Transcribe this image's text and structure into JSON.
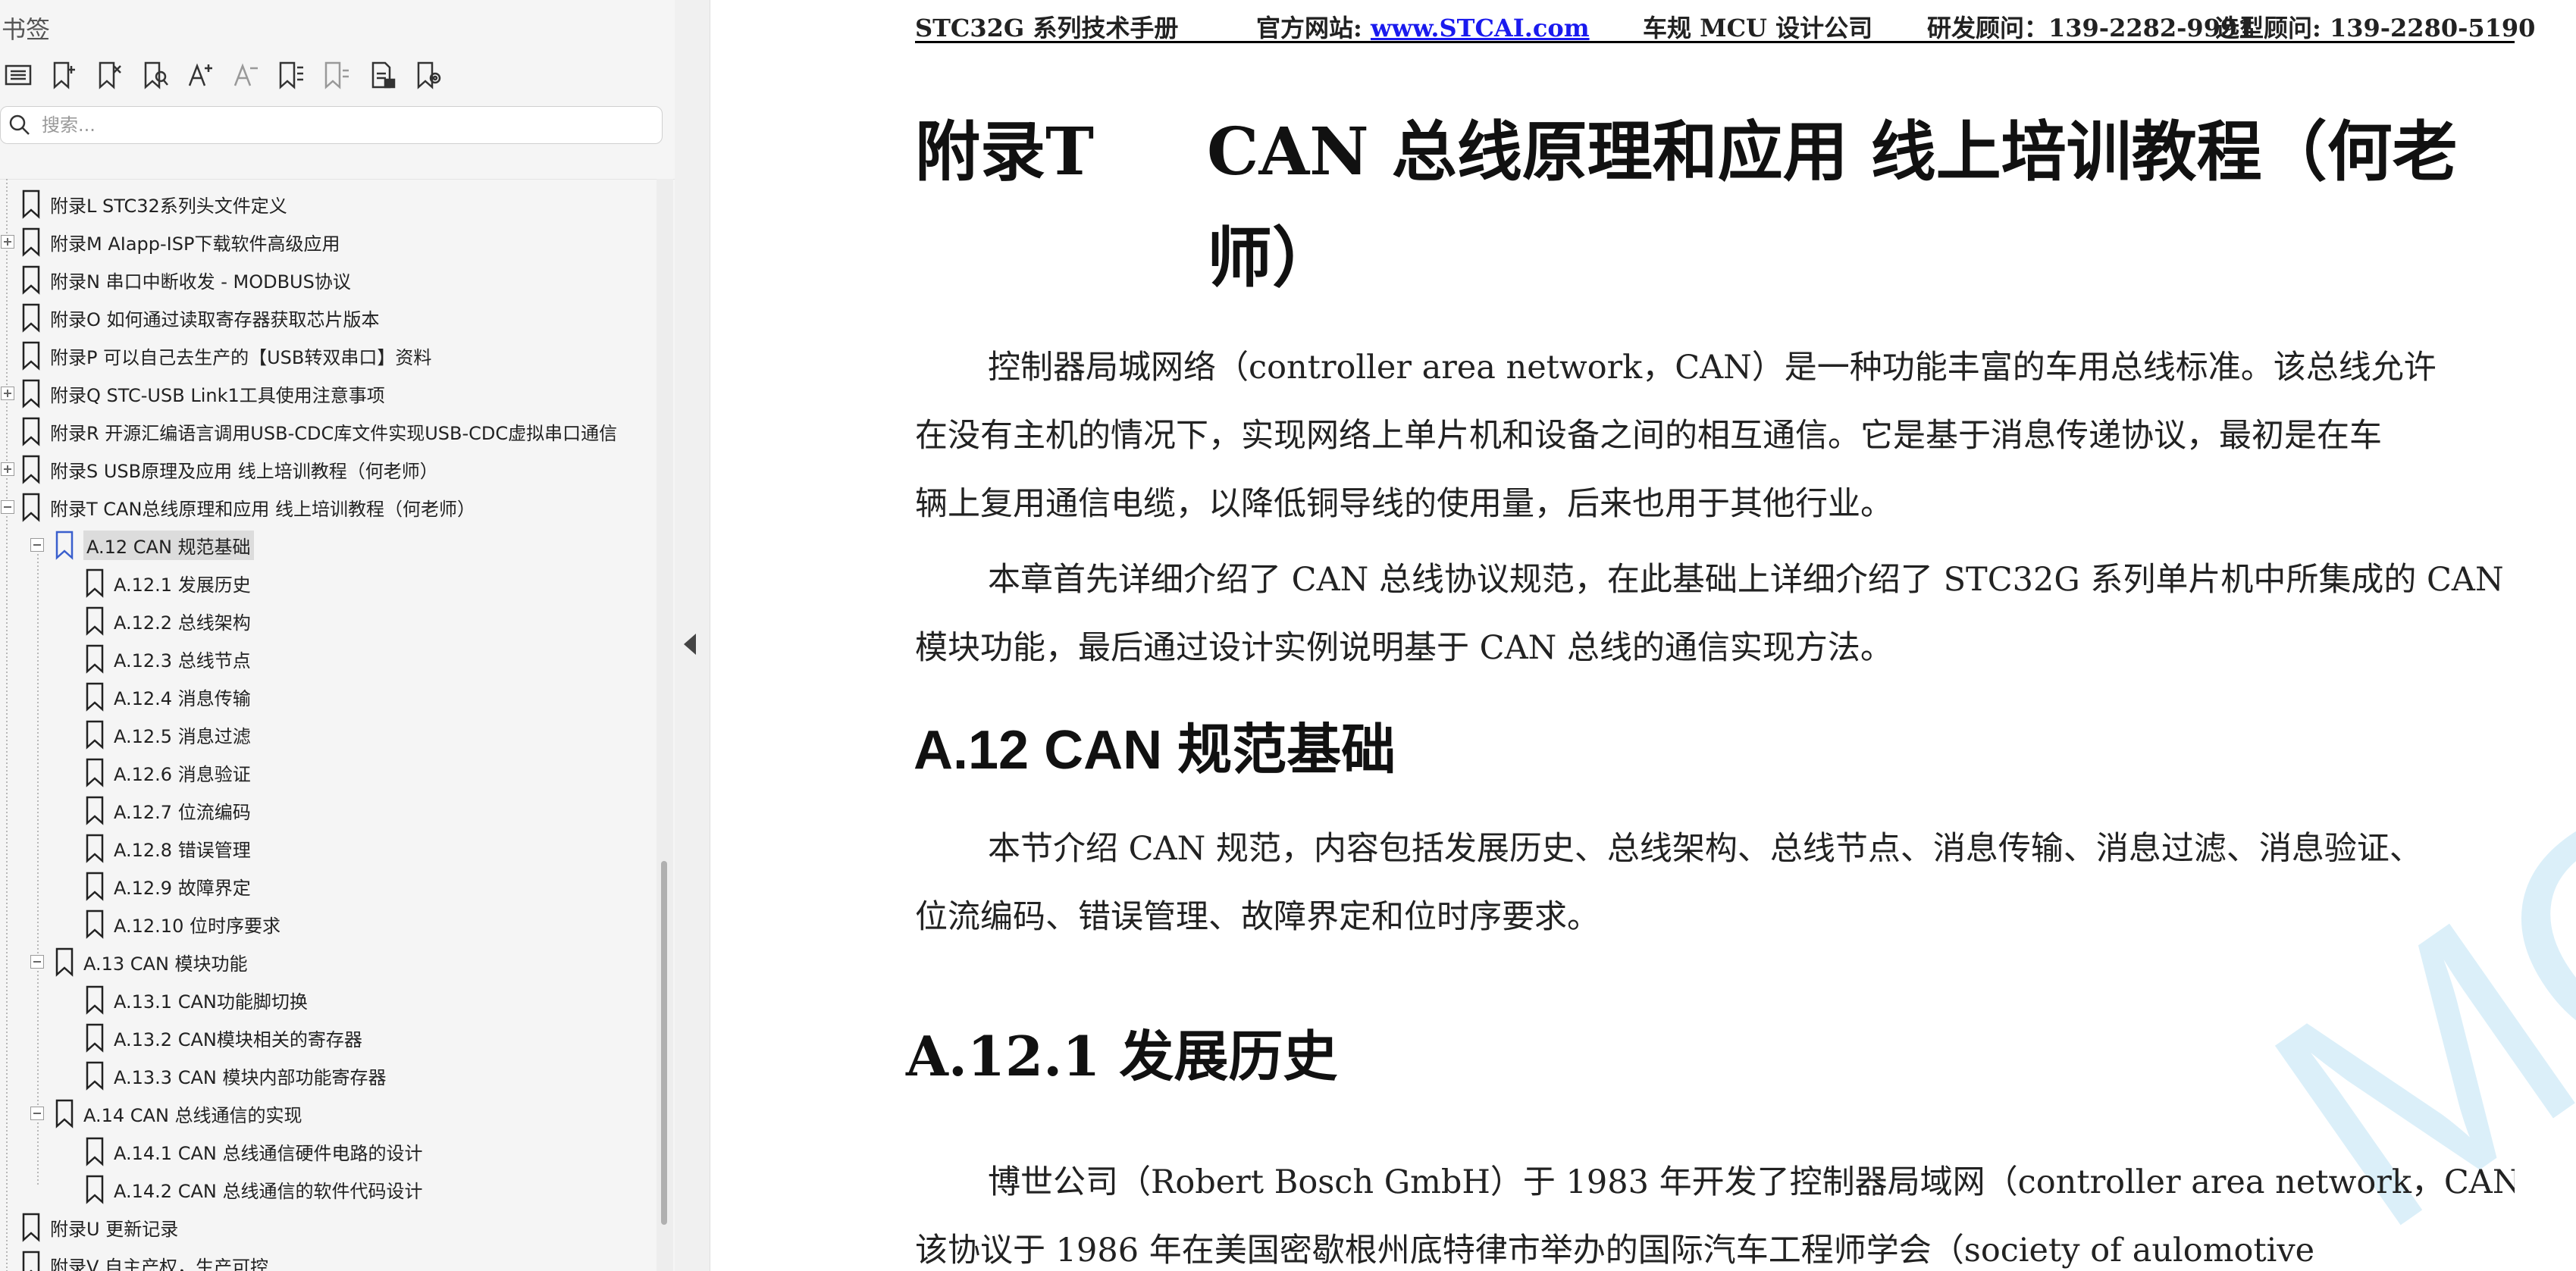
{
  "sidebar": {
    "title": "书签",
    "search_placeholder": "搜索...",
    "tools": [
      "list-icon",
      "add-bookmark-icon",
      "delete-bookmark-icon",
      "find-bookmark-icon",
      "increase-font-icon",
      "decrease-font-icon",
      "expand-all-icon",
      "collapse-all-icon",
      "export-bookmark-icon",
      "bookmark-settings-icon"
    ],
    "items": [
      {
        "label": "附录L  STC32系列头文件定义",
        "level": 0,
        "expander": "none"
      },
      {
        "label": "附录M  AIapp-ISP下载软件高级应用",
        "level": 0,
        "expander": "plus"
      },
      {
        "label": "附录N  串口中断收发 - MODBUS协议",
        "level": 0,
        "expander": "none"
      },
      {
        "label": "附录O  如何通过读取寄存器获取芯片版本",
        "level": 0,
        "expander": "none"
      },
      {
        "label": "附录P  可以自己去生产的【USB转双串口】资料",
        "level": 0,
        "expander": "none"
      },
      {
        "label": "附录Q  STC-USB Link1工具使用注意事项",
        "level": 0,
        "expander": "plus"
      },
      {
        "label": "附录R  开源汇编语言调用USB-CDC库文件实现USB-CDC虚拟串口通信",
        "level": 0,
        "expander": "none"
      },
      {
        "label": "附录S  USB原理及应用 线上培训教程（何老师）",
        "level": 0,
        "expander": "plus"
      },
      {
        "label": "附录T  CAN总线原理和应用 线上培训教程（何老师）",
        "level": 0,
        "expander": "minus"
      },
      {
        "label": "A.12 CAN 规范基础",
        "level": 1,
        "expander": "minus",
        "selected": true
      },
      {
        "label": "A.12.1 发展历史",
        "level": 2,
        "expander": "none"
      },
      {
        "label": "A.12.2 总线架构",
        "level": 2,
        "expander": "none"
      },
      {
        "label": "A.12.3 总线节点",
        "level": 2,
        "expander": "none"
      },
      {
        "label": "A.12.4 消息传输",
        "level": 2,
        "expander": "none"
      },
      {
        "label": "A.12.5 消息过滤",
        "level": 2,
        "expander": "none"
      },
      {
        "label": "A.12.6 消息验证",
        "level": 2,
        "expander": "none"
      },
      {
        "label": "A.12.7 位流编码",
        "level": 2,
        "expander": "none"
      },
      {
        "label": "A.12.8 错误管理",
        "level": 2,
        "expander": "none"
      },
      {
        "label": "A.12.9 故障界定",
        "level": 2,
        "expander": "none"
      },
      {
        "label": "A.12.10 位时序要求",
        "level": 2,
        "expander": "none"
      },
      {
        "label": "A.13 CAN 模块功能",
        "level": 1,
        "expander": "minus"
      },
      {
        "label": "A.13.1 CAN功能脚切换",
        "level": 2,
        "expander": "none"
      },
      {
        "label": "A.13.2 CAN模块相关的寄存器",
        "level": 2,
        "expander": "none"
      },
      {
        "label": "A.13.3 CAN 模块内部功能寄存器",
        "level": 2,
        "expander": "none"
      },
      {
        "label": "A.14 CAN 总线通信的实现",
        "level": 1,
        "expander": "minus"
      },
      {
        "label": "A.14.1 CAN 总线通信硬件电路的设计",
        "level": 2,
        "expander": "none"
      },
      {
        "label": "A.14.2 CAN 总线通信的软件代码设计",
        "level": 2,
        "expander": "none"
      },
      {
        "label": "附录U  更新记录",
        "level": 0,
        "expander": "none"
      },
      {
        "label": "附录V  自主产权，生产可控",
        "level": 0,
        "expander": "none"
      }
    ]
  },
  "document": {
    "header": {
      "manual": "STC32G 系列技术手册",
      "site_label": "官方网站: ",
      "site_link": "www.STCAI.com",
      "company": "车规 MCU 设计公司",
      "rd_contact": "研发顾问：139-2282-9991",
      "sel_contact": "选型顾问: 139-2280-5190"
    },
    "appendix_label": "附录T",
    "title_line1": "CAN  总线原理和应用  线上培训教程（何老",
    "title_line2": "师）",
    "intro_lines": [
      "控制器局城网络（controller area network，CAN）是一种功能丰富的车用总线标准。该总线允许",
      "在没有主机的情况下，实现网络上单片机和设备之间的相互通信。它是基于消息传递协议，最初是在车",
      "辆上复用通信电缆，以降低铜导线的使用量，后来也用于其他行业。"
    ],
    "chapter_lines": [
      "本章首先详细介绍了 CAN 总线协议规范，在此基础上详细介绍了 STC32G 系列单片机中所集成的 CAN",
      "模块功能，最后通过设计实例说明基于 CAN 总线的通信实现方法。"
    ],
    "section_heading": "A.12  CAN  规范基础",
    "section_lines": [
      "本节介绍 CAN 规范，内容包括发展历史、总线架构、总线节点、消息传输、消息过滤、消息验证、",
      "位流编码、错误管理、故障界定和位时序要求。"
    ],
    "subsection_heading": "A.12.1     发展历史",
    "history_lines": [
      "博世公司（Robert Bosch GmbH）于 1983 年开发了控制器局域网（controller area network，CAN）。",
      "该协议于  1986  年在美国密歇根州底特律市举办的国际汽车工程师学会（society  of  aulomotive"
    ],
    "watermark": "MCU"
  }
}
